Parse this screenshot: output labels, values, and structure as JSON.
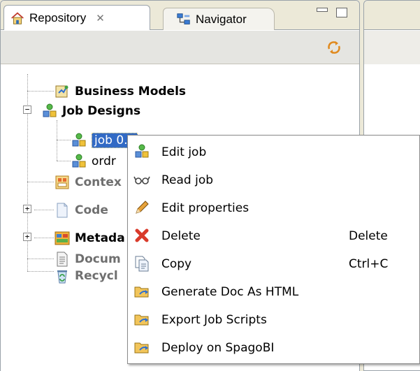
{
  "tabs": {
    "repository": {
      "label": "Repository",
      "close": "✕"
    },
    "navigator": {
      "label": "Navigator"
    }
  },
  "tree": {
    "business_models": "Business Models",
    "job_designs": "Job Designs",
    "job_selected": "job 0.1",
    "job_second": "ordr",
    "contexts": "Contex",
    "code": "Code",
    "metadata": "Metada",
    "documentation": "Docum",
    "recycle_bin": "Recycl",
    "expand_plus": "+",
    "expand_minus": "−"
  },
  "context_menu": {
    "items": [
      {
        "label": "Edit job",
        "accelerator": ""
      },
      {
        "label": "Read job",
        "accelerator": ""
      },
      {
        "label": "Edit properties",
        "accelerator": ""
      },
      {
        "label": "Delete",
        "accelerator": "Delete"
      },
      {
        "label": "Copy",
        "accelerator": "Ctrl+C"
      },
      {
        "label": "Generate Doc As HTML",
        "accelerator": ""
      },
      {
        "label": "Export Job Scripts",
        "accelerator": ""
      },
      {
        "label": "Deploy on SpagoBI",
        "accelerator": ""
      }
    ]
  },
  "icons": {
    "repository": "house-icon",
    "navigator": "navigator-icon",
    "sync": "sync-icon",
    "business_models": "business-model-icon",
    "job": "job-icon",
    "contexts": "context-icon",
    "code": "document-icon",
    "metadata": "metadata-icon",
    "documentation": "document-icon",
    "recycle_bin": "recycle-bin-icon",
    "read_job": "glasses-icon",
    "edit_properties": "pencil-icon",
    "delete": "red-x-icon",
    "copy": "copy-icon",
    "export": "export-folder-icon"
  },
  "colors": {
    "selection": "#316ac5",
    "delete_red": "#d93a2b",
    "chrome": "#ece9d8"
  }
}
